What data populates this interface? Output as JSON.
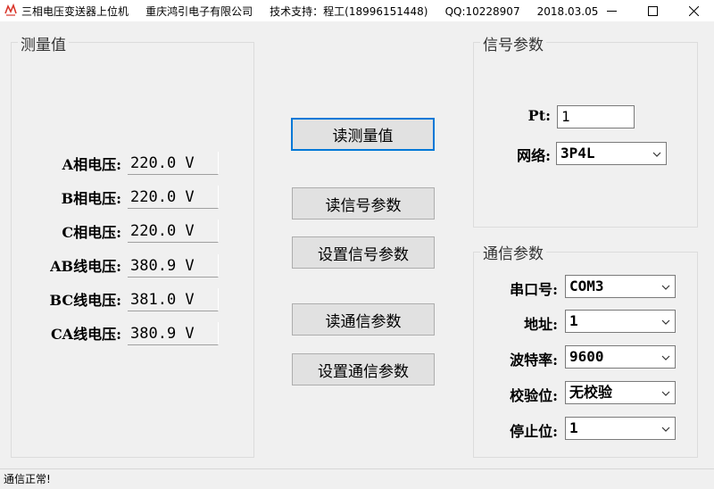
{
  "window": {
    "title": "三相电压变送器上位机     重庆鸿引电子有限公司     技术支持：程工(18996151448)     QQ:10228907     2018.03.05"
  },
  "measure_group": {
    "title": "测量值",
    "rows": [
      {
        "label": "A相电压:",
        "value": "220.0 V"
      },
      {
        "label": "B相电压:",
        "value": "220.0 V"
      },
      {
        "label": "C相电压:",
        "value": "220.0 V"
      },
      {
        "label": "AB线电压:",
        "value": "380.9 V"
      },
      {
        "label": "BC线电压:",
        "value": "381.0 V"
      },
      {
        "label": "CA线电压:",
        "value": "380.9 V"
      }
    ]
  },
  "buttons": {
    "read_measure": "读测量值",
    "read_signal": "读信号参数",
    "set_signal": "设置信号参数",
    "read_comm": "读通信参数",
    "set_comm": "设置通信参数"
  },
  "signal_group": {
    "title": "信号参数",
    "pt_label": "Pt:",
    "pt_value": "1",
    "network_label": "网络:",
    "network_value": "3P4L"
  },
  "comm_group": {
    "title": "通信参数",
    "port_label": "串口号:",
    "port_value": "COM3",
    "address_label": "地址:",
    "address_value": "1",
    "baud_label": "波特率:",
    "baud_value": "9600",
    "parity_label": "校验位:",
    "parity_value": "无校验",
    "stopbits_label": "停止位:",
    "stopbits_value": "1"
  },
  "status": {
    "text": "通信正常!"
  },
  "colors": {
    "default_button_border": "#0078d7",
    "window_bg": "#f0f0f0",
    "app_icon": "#d9362b"
  }
}
